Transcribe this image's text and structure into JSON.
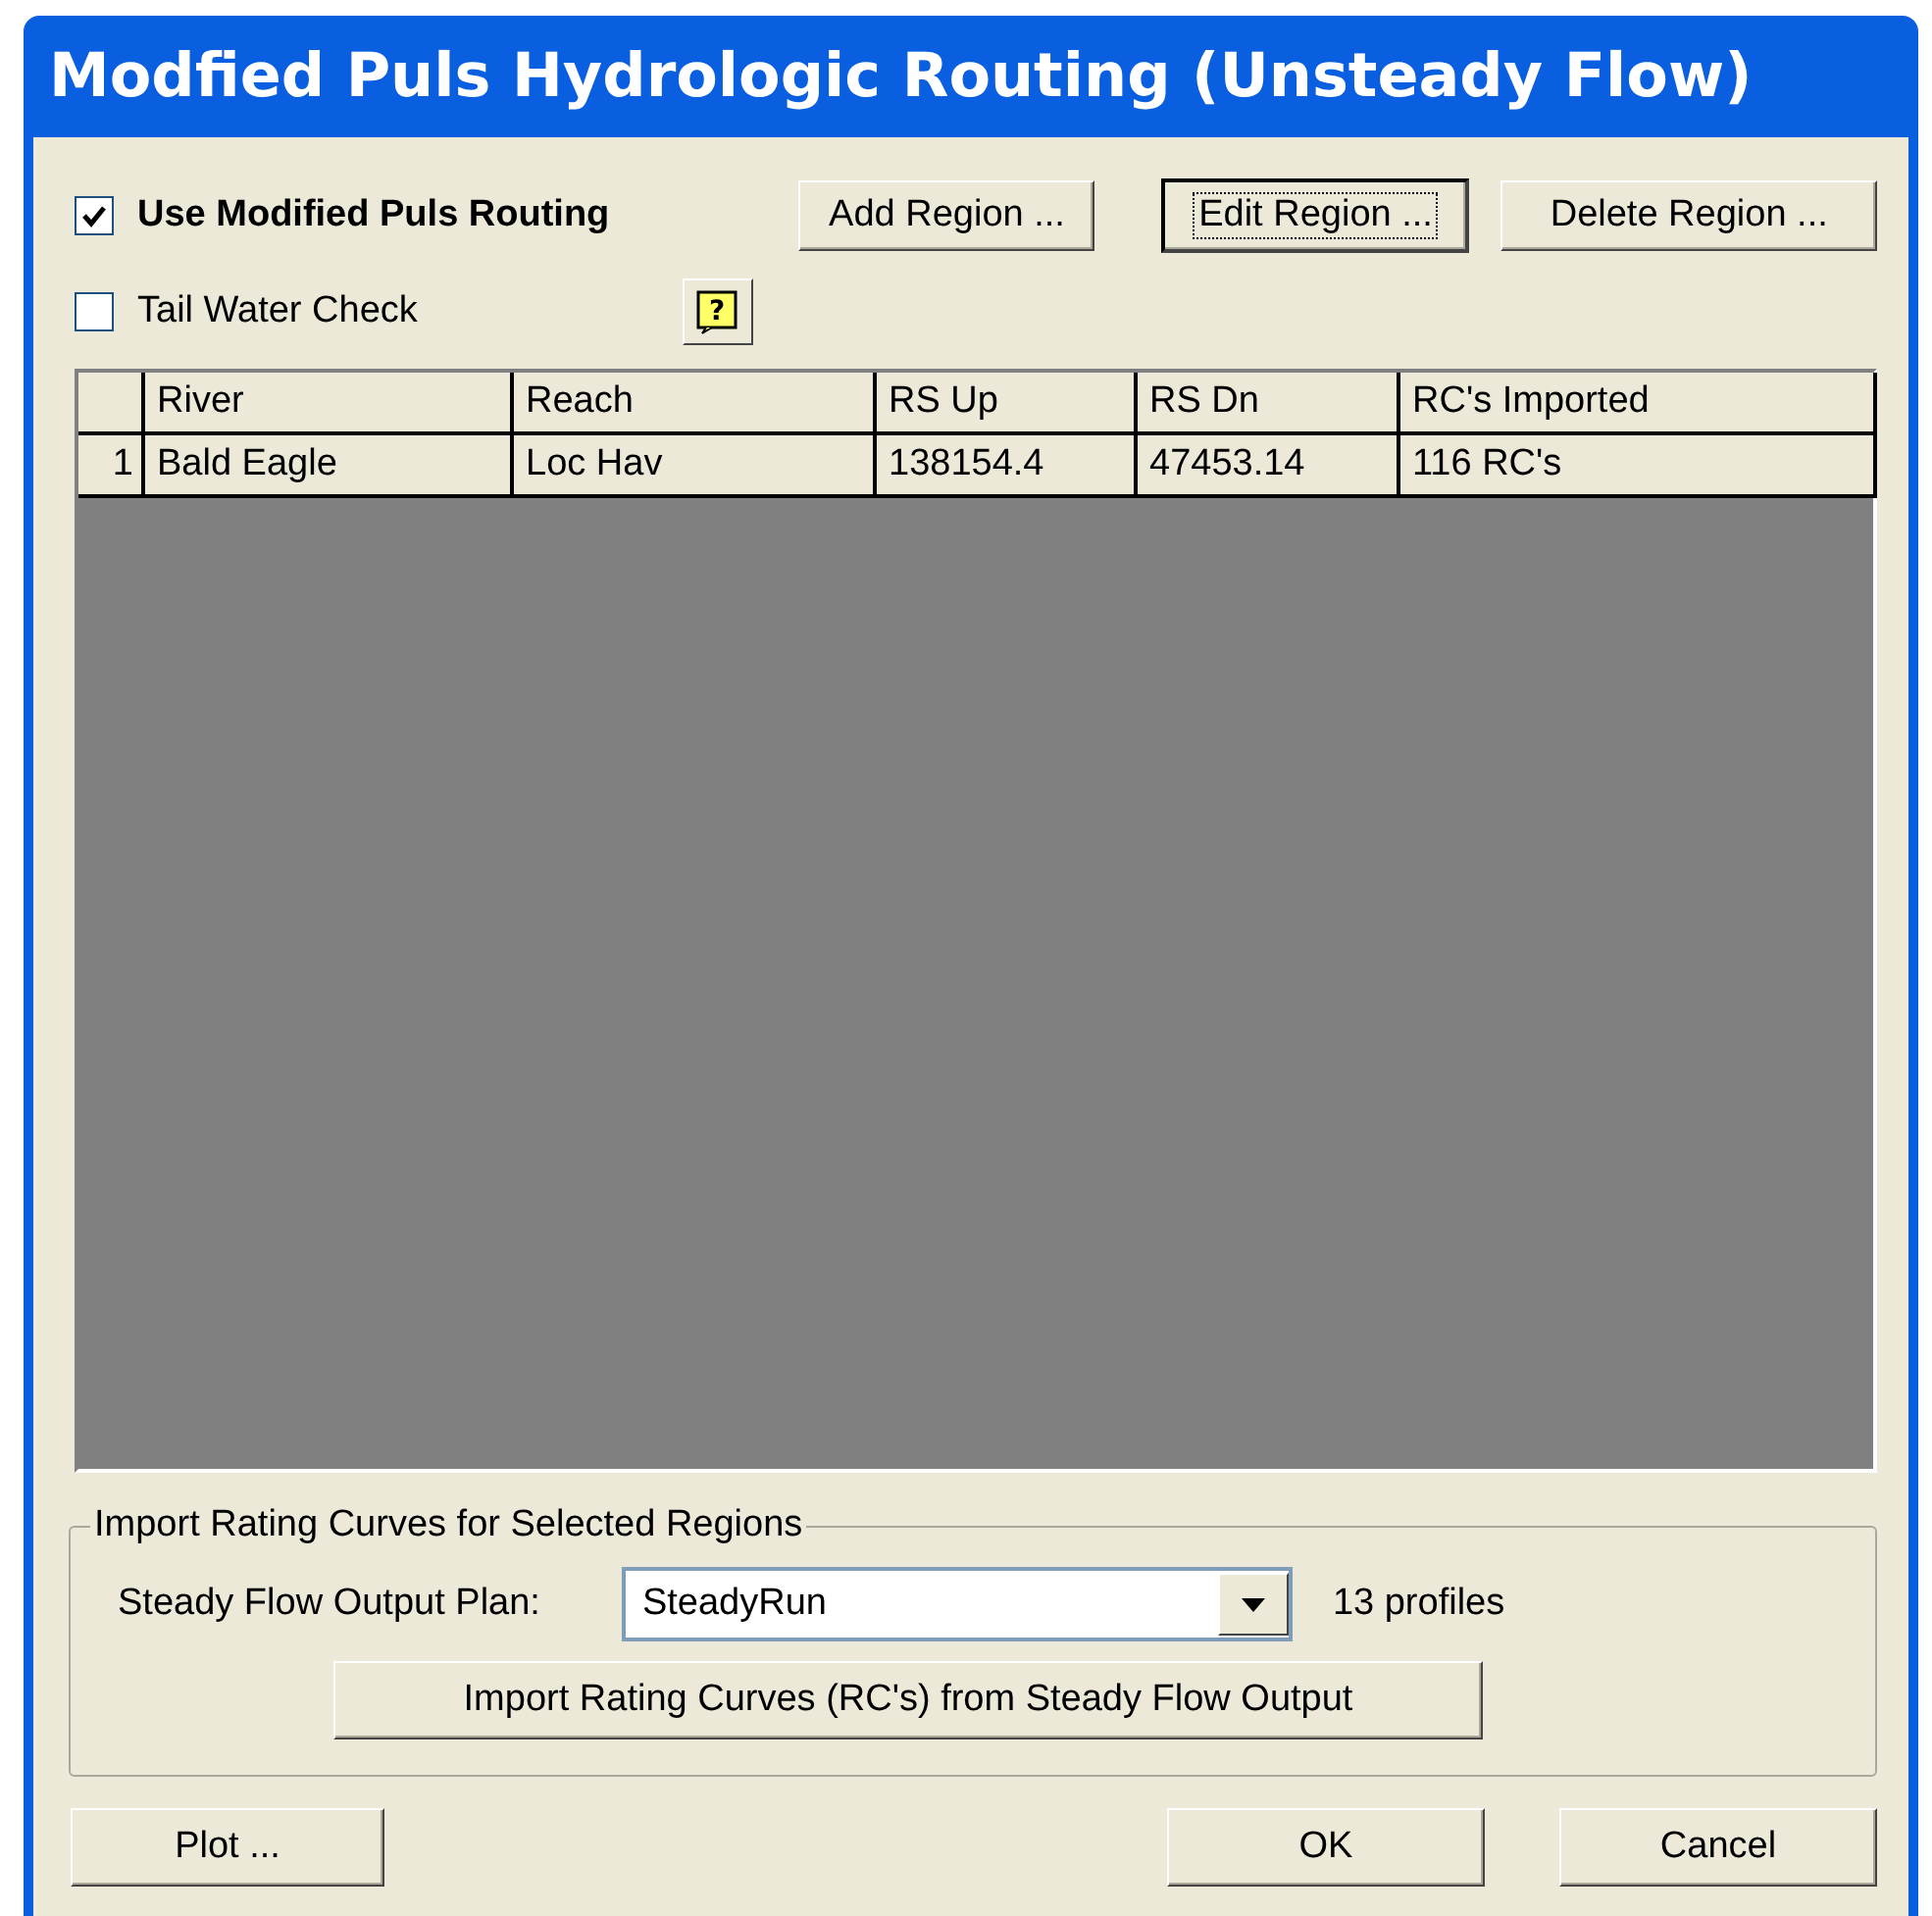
{
  "window": {
    "title": "Modfied Puls Hydrologic Routing (Unsteady Flow)"
  },
  "options": [
    {
      "label": "Use Modified Puls Routing",
      "checked": true,
      "bold": true
    },
    {
      "label": "Tail Water Check",
      "checked": false,
      "bold": false
    }
  ],
  "region_buttons": [
    {
      "label": "Add Region ...",
      "focused": false
    },
    {
      "label": "Edit Region ...",
      "focused": true
    },
    {
      "label": "Delete Region ...",
      "focused": false
    }
  ],
  "help_button": {
    "label": "?"
  },
  "table": {
    "columns": [
      "River",
      "Reach",
      "RS Up",
      "RS Dn",
      "RC's Imported"
    ],
    "rows": [
      {
        "number": "1",
        "cells": [
          "Bald Eagle",
          "Loc Hav",
          "138154.4",
          "47453.14",
          "116 RC's"
        ]
      }
    ]
  },
  "import_group": {
    "title": "Import Rating Curves for Selected Regions",
    "plan_label": "Steady Flow Output Plan:",
    "plan_value": "SteadyRun",
    "profiles": "13 profiles",
    "import_button": "Import Rating Curves (RC's) from Steady Flow Output"
  },
  "buttons": [
    {
      "label": "Plot ...",
      "focused": false
    },
    {
      "label": "OK",
      "focused": false
    },
    {
      "label": "Cancel",
      "focused": false
    }
  ]
}
